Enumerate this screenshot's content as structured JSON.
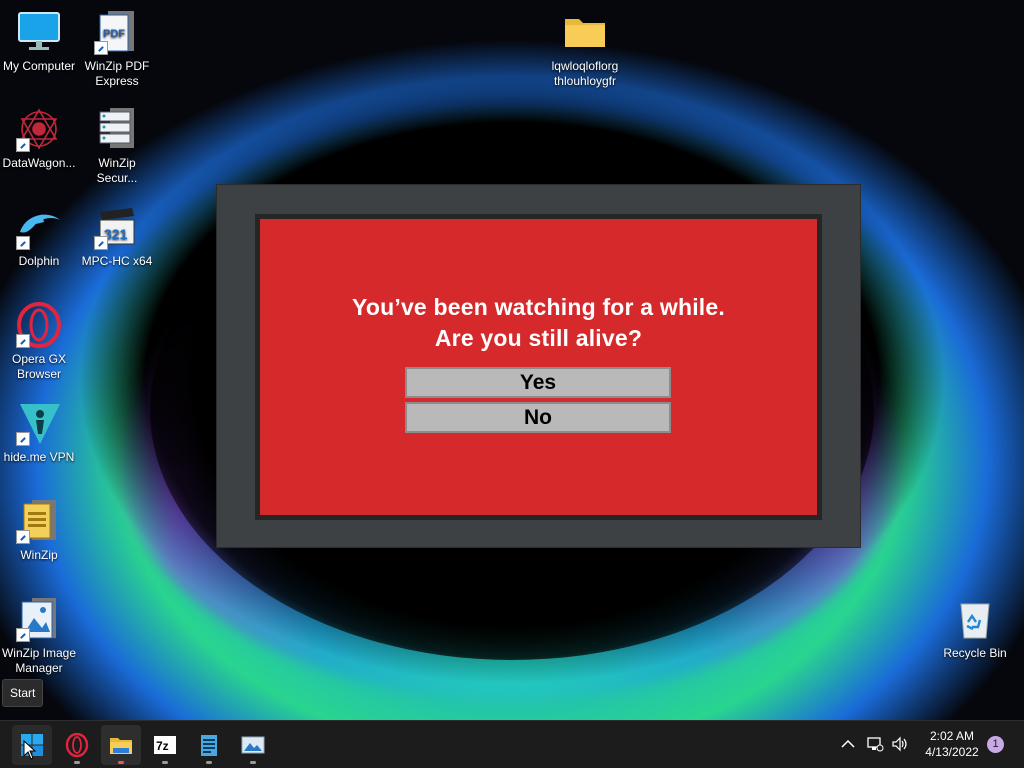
{
  "desktop_icons": [
    {
      "label": "My Computer",
      "icon": "monitor-icon"
    },
    {
      "label": "WinZip PDF Express",
      "icon": "pdf-icon"
    },
    {
      "label": "lqwloqloflorg thlouhloygfr",
      "icon": "folder-icon"
    },
    {
      "label": "DataWagon...",
      "icon": "datawagon-icon"
    },
    {
      "label": "WinZip Secur...",
      "icon": "server-icon"
    },
    {
      "label": "Dolphin",
      "icon": "dolphin-icon"
    },
    {
      "label": "MPC-HC x64",
      "icon": "clapperboard-icon"
    },
    {
      "label": "Opera GX Browser",
      "icon": "opera-icon"
    },
    {
      "label": "hide.me VPN",
      "icon": "vpn-icon"
    },
    {
      "label": "WinZip",
      "icon": "zip-icon"
    },
    {
      "label": "WinZip Image Manager",
      "icon": "image-manager-icon"
    },
    {
      "label": "Recycle Bin",
      "icon": "recycle-bin-icon"
    }
  ],
  "dialog": {
    "line1": "You’ve been watching for a while.",
    "line2": "Are you still alive?",
    "yes_label": "Yes",
    "no_label": "No"
  },
  "tooltip": {
    "text": "Start"
  },
  "taskbar": {
    "apps": [
      "start-icon",
      "opera-icon",
      "file-explorer-icon",
      "7zip-icon",
      "notepad-icon",
      "image-viewer-icon"
    ],
    "sevenzip_text": "7z",
    "time": "2:02 AM",
    "date": "4/13/2022",
    "notification_count": "1"
  },
  "colors": {
    "dialog_red": "#d6292c",
    "dialog_frame": "#3e4144",
    "button_gray": "#b9b9b9",
    "taskbar": "#1c1c1c"
  }
}
